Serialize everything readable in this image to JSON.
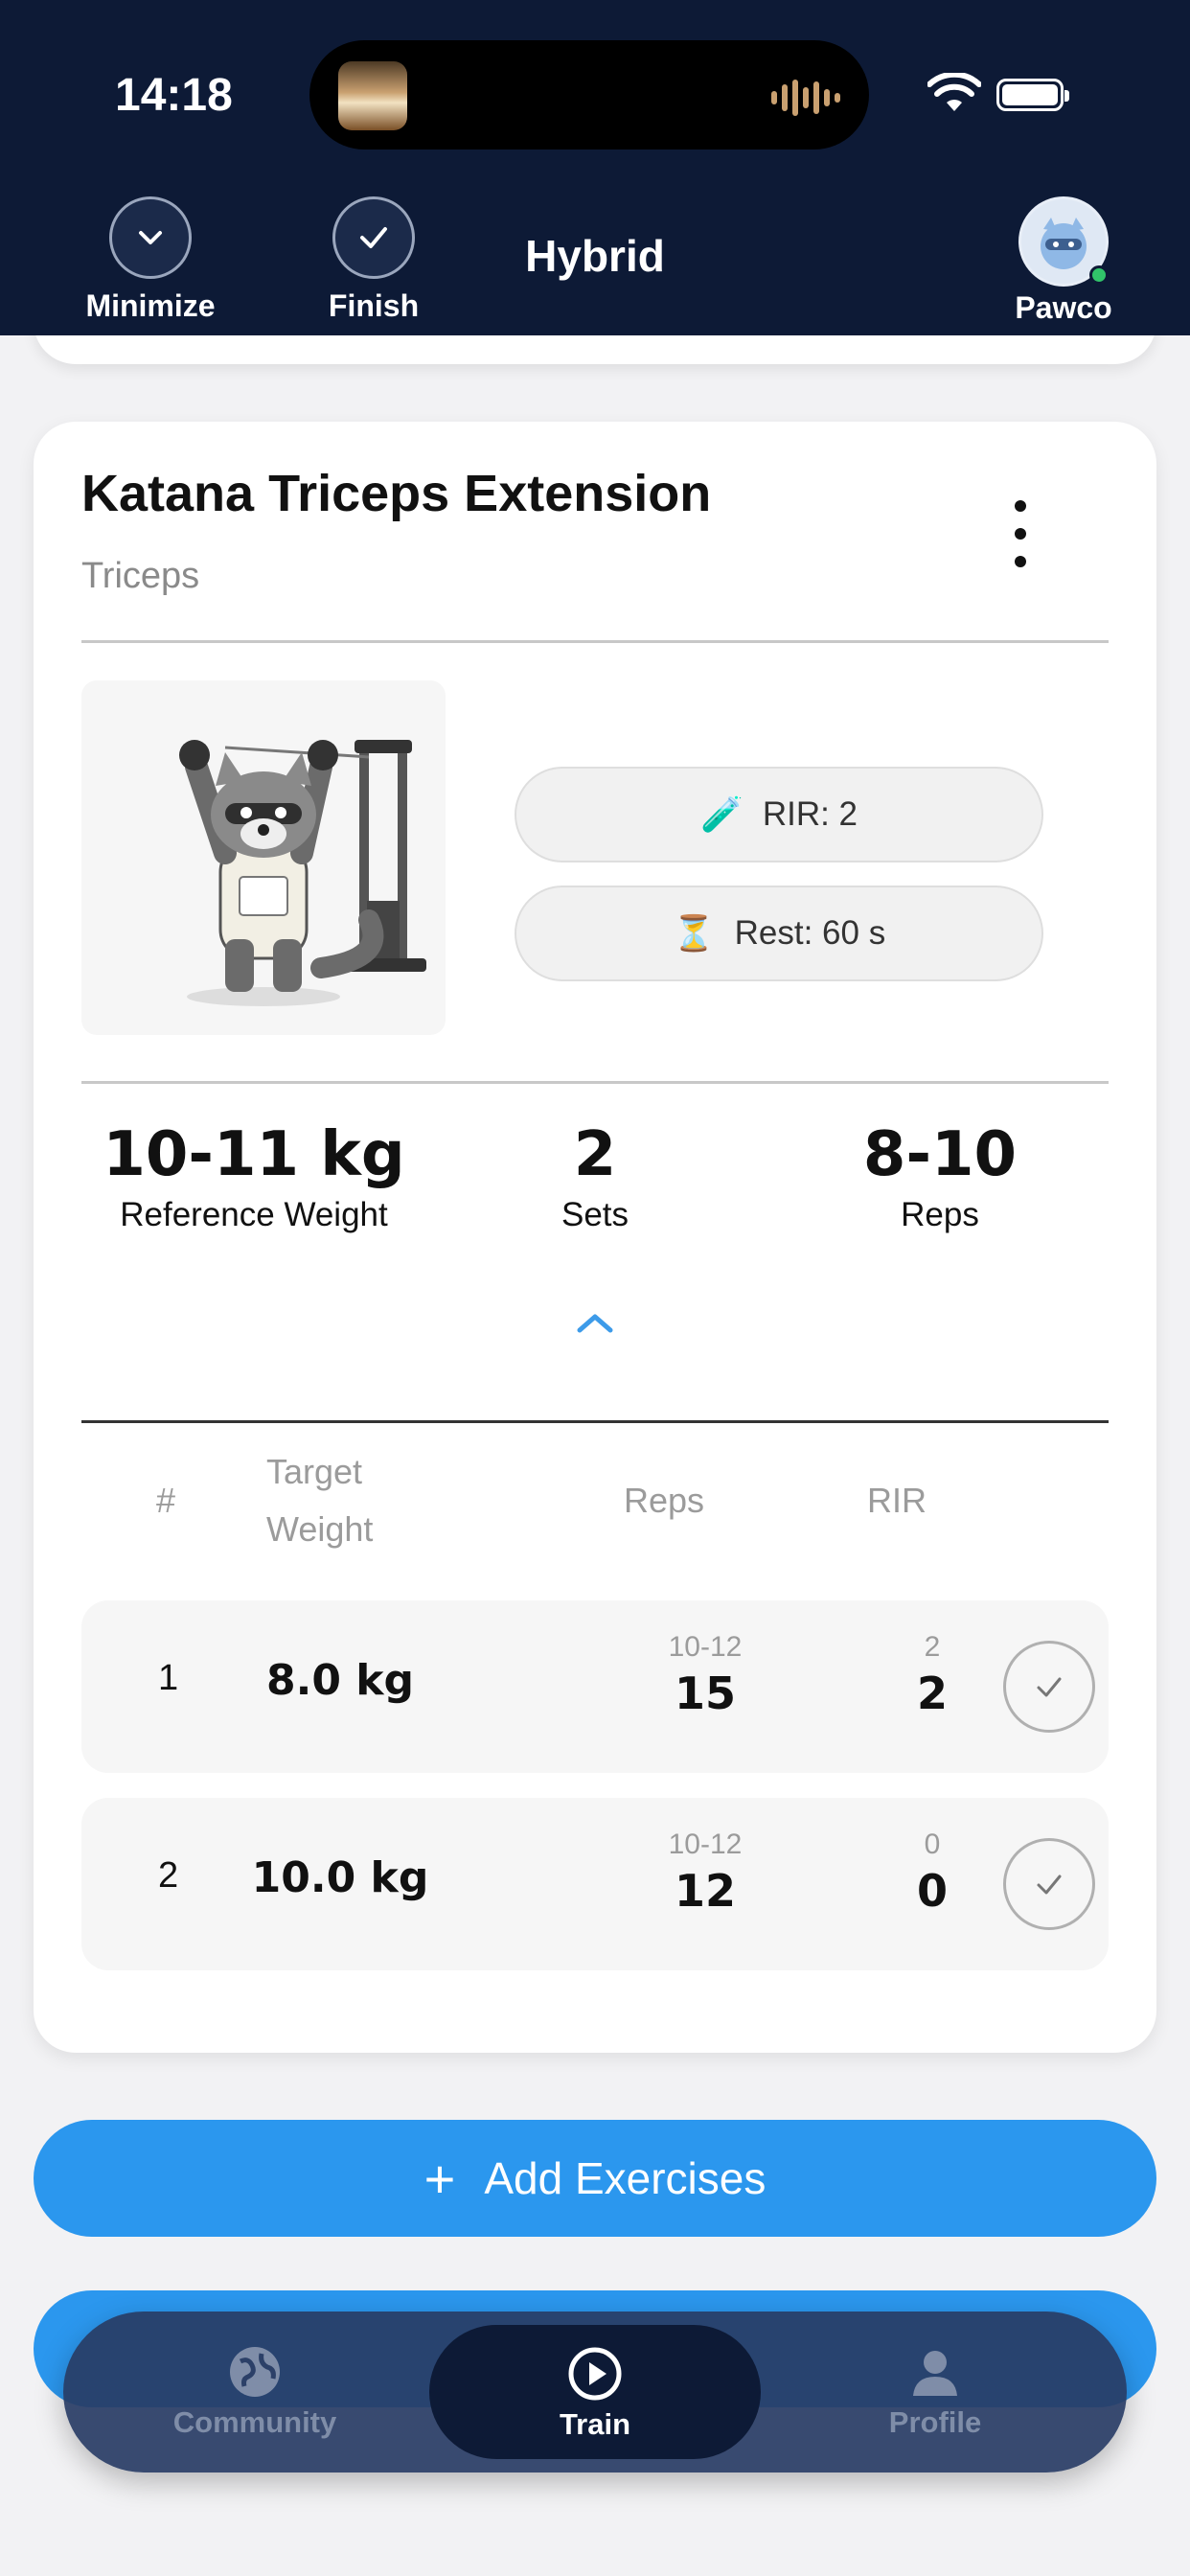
{
  "status_bar": {
    "time": "14:18"
  },
  "header": {
    "title": "Hybrid",
    "minimize_label": "Minimize",
    "finish_label": "Finish",
    "user_name": "Pawco"
  },
  "exercise": {
    "name": "Katana Triceps Extension",
    "muscle": "Triceps",
    "rir_pill": "RIR: 2",
    "rest_pill": "Rest: 60 s",
    "summary": {
      "weight_value": "10-11 kg",
      "weight_label": "Reference Weight",
      "sets_value": "2",
      "sets_label": "Sets",
      "reps_value": "8-10",
      "reps_label": "Reps"
    },
    "table_headers": {
      "num": "#",
      "target_weight_line1": "Target",
      "target_weight_line2": "Weight",
      "reps": "Reps",
      "rir": "RIR"
    },
    "sets": [
      {
        "num": "1",
        "weight": "8.0 kg",
        "reps_target": "10-12",
        "reps_actual": "15",
        "rir_target": "2",
        "rir_actual": "2"
      },
      {
        "num": "2",
        "weight": "10.0 kg",
        "reps_target": "10-12",
        "reps_actual": "12",
        "rir_target": "0",
        "rir_actual": "0"
      }
    ]
  },
  "actions": {
    "add_exercises": "Add Exercises"
  },
  "tabbar": {
    "community": "Community",
    "train": "Train",
    "profile": "Profile"
  },
  "colors": {
    "header_bg": "#0d1a36",
    "accent_blue": "#2b97ee",
    "online_green": "#31c46a"
  }
}
